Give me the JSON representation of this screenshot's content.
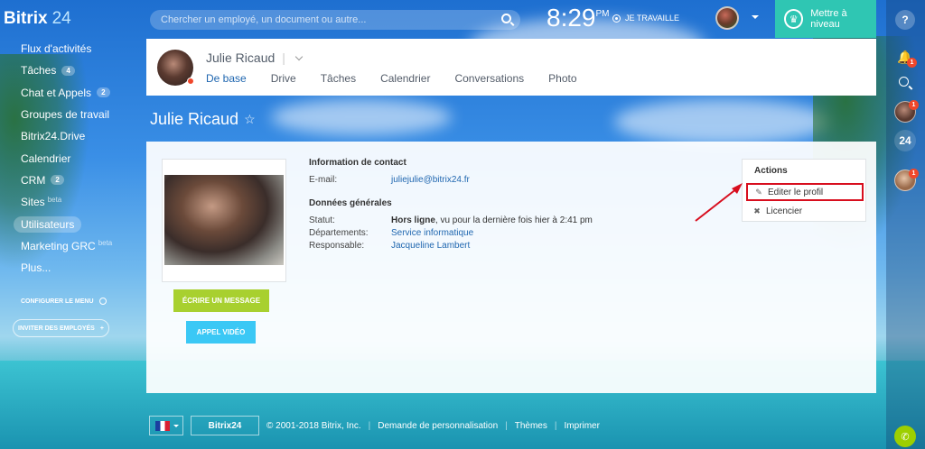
{
  "header": {
    "brand_name": "Bitrix",
    "brand_number": "24",
    "search_placeholder": "Chercher un employé, un document ou autre...",
    "clock_time": "8:29",
    "clock_ampm": "PM",
    "work_status": "JE TRAVAILLE",
    "upgrade_label": "Mettre à niveau"
  },
  "sidebar": {
    "items": [
      {
        "label": "Flux d'activités",
        "counter": "",
        "beta": ""
      },
      {
        "label": "Tâches",
        "counter": "4",
        "beta": ""
      },
      {
        "label": "Chat et Appels",
        "counter": "2",
        "beta": ""
      },
      {
        "label": "Groupes de travail",
        "counter": "",
        "beta": ""
      },
      {
        "label": "Bitrix24.Drive",
        "counter": "",
        "beta": ""
      },
      {
        "label": "Calendrier",
        "counter": "",
        "beta": ""
      },
      {
        "label": "CRM",
        "counter": "2",
        "beta": ""
      },
      {
        "label": "Sites",
        "counter": "",
        "beta": "beta"
      },
      {
        "label": "Utilisateurs",
        "counter": "",
        "beta": ""
      },
      {
        "label": "Marketing GRC",
        "counter": "",
        "beta": "beta"
      },
      {
        "label": "Plus...",
        "counter": "",
        "beta": ""
      }
    ],
    "configure_label": "CONFIGURER LE MENU",
    "invite_label": "INVITER DES EMPLOYÉS",
    "invite_plus": "+"
  },
  "profile": {
    "name": "Julie Ricaud",
    "name_sep": "|",
    "tabs": [
      "De base",
      "Drive",
      "Tâches",
      "Calendrier",
      "Conversations",
      "Photo"
    ],
    "page_title": "Julie Ricaud",
    "star": "☆"
  },
  "buttons": {
    "write_message": "ÉCRIRE UN MESSAGE",
    "video_call": "APPEL VIDÉO"
  },
  "contact": {
    "heading": "Information de contact",
    "email_label": "E-mail:",
    "email_value": "juliejulie@bitrix24.fr"
  },
  "general": {
    "heading": "Données générales",
    "status_label": "Statut:",
    "status_value": "Hors ligne",
    "status_detail": ", vu pour la dernière fois hier à 2:41 pm",
    "departments_label": "Départements:",
    "departments_value": "Service informatique",
    "manager_label": "Responsable:",
    "manager_value": "Jacqueline Lambert"
  },
  "actions": {
    "heading": "Actions",
    "edit_label": "Editer le profil",
    "fire_label": "Licencier"
  },
  "footer": {
    "logo": "Bitrix24",
    "copyright": "© 2001-2018 Bitrix, Inc.",
    "customization": "Demande de personnalisation",
    "themes": "Thèmes",
    "print": "Imprimer"
  },
  "rightbar": {
    "help": "?",
    "bell_badge": "1",
    "b24": "24",
    "avatar1_badge": "1",
    "avatar2_badge": "1"
  },
  "colors": {
    "accent": "#2fc6b3",
    "link": "#2067b0",
    "write_button": "#a8d02f",
    "video_button": "#3bc8f5",
    "highlight": "#d80e1e"
  }
}
